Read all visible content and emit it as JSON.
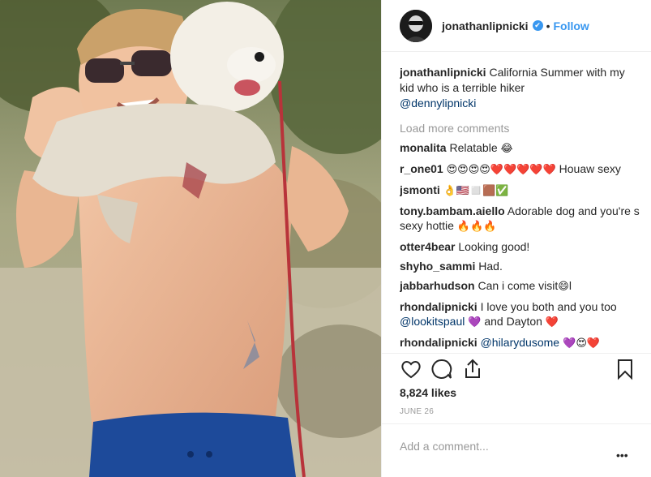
{
  "post": {
    "username": "jonathanlipnicki",
    "verified_mark": "✔",
    "separator": "•",
    "follow_label": "Follow",
    "caption_text": " California Summer with my kid who is a terrible hiker",
    "caption_mention": "@dennylipnicki",
    "load_more": "Load more comments",
    "likes": "8,824 likes",
    "date": "JUNE 26",
    "comment_placeholder": "Add a comment...",
    "more_glyph": "•••"
  },
  "comments": [
    {
      "user": "monalita",
      "text": " Relatable ",
      "emoji": "😂"
    },
    {
      "user": "r_one01",
      "text": " ",
      "emoji": "😍😍😍😍❤️❤️❤️❤️❤️",
      "tail": " Houaw sexy"
    },
    {
      "user": "jsmonti",
      "text": " ",
      "emoji": "👌🇺🇸◻️🟫✅"
    },
    {
      "user": "tony.bambam.aiello",
      "text": " Adorable dog and you're s sexy hottie ",
      "emoji": "🔥🔥🔥"
    },
    {
      "user": "otter4bear",
      "text": " Looking good!"
    },
    {
      "user": "shyho_sammi",
      "text": " Had."
    },
    {
      "user": "jabbarhudson",
      "text": " Can i come visit",
      "emoji": "😄",
      "tail": "l"
    },
    {
      "user": "rhondalipnicki",
      "text": " I love you both and you too ",
      "mention": "@lookitspaul",
      "emoji": "💜",
      "tail": " and Dayton ",
      "emoji2": "❤️"
    },
    {
      "user": "rhondalipnicki",
      "text": " ",
      "mention": "@hilarydusome",
      "emoji": " 💜😍❤️"
    }
  ],
  "icons": [
    "heart-icon",
    "comment-icon",
    "share-icon",
    "bookmark-icon"
  ],
  "colors": {
    "link": "#3897f0",
    "mention": "#003569",
    "muted": "#999999",
    "text": "#262626"
  }
}
